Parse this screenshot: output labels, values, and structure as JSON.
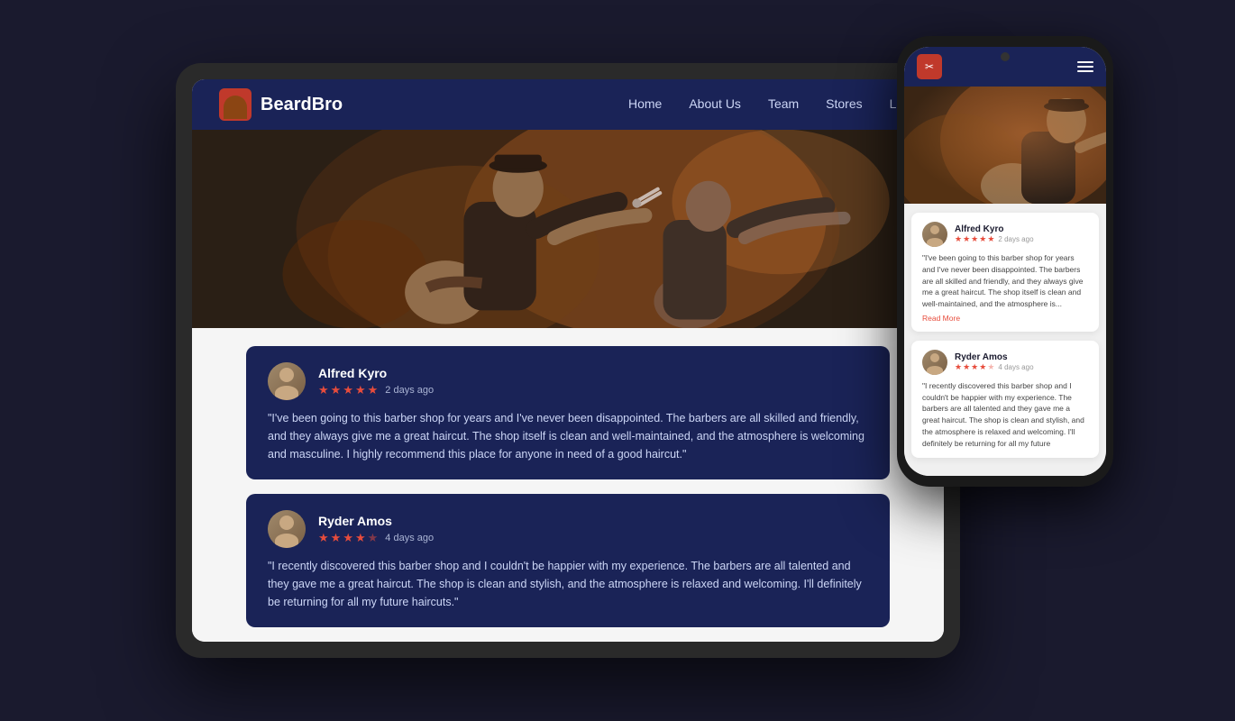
{
  "brand": {
    "name": "BeardBro",
    "logo_icon": "✂"
  },
  "nav": {
    "links": [
      "Home",
      "About Us",
      "Team",
      "Stores",
      "Labs"
    ]
  },
  "reviews": [
    {
      "id": 1,
      "name": "Alfred Kyro",
      "date": "2 days ago",
      "stars": 5,
      "half_star": false,
      "text": "\"I've been going to this barber shop for years and I've never been disappointed. The barbers are all skilled and friendly, and they always give me a great haircut. The shop itself is clean and well-maintained, and the atmosphere is welcoming and masculine. I highly recommend this place for anyone in need of a good haircut.\""
    },
    {
      "id": 2,
      "name": "Ryder Amos",
      "date": "4 days ago",
      "stars": 4,
      "half_star": true,
      "text": "\"I recently discovered this barber shop and I couldn't be happier with my experience. The barbers are all talented and they gave me a great haircut. The shop is clean and stylish, and the atmosphere is relaxed and welcoming. I'll definitely be returning for all my future haircuts.\""
    }
  ],
  "phone_reviews": [
    {
      "id": 1,
      "name": "Alfred Kyro",
      "date": "2 days ago",
      "stars": 5,
      "half_star": false,
      "text": "\"I've been going to this barber shop for years and I've never been disappointed. The barbers are all skilled and friendly, and they always give me a great haircut. The shop itself is clean and well-maintained, and the atmosphere is...",
      "read_more": "Read More"
    },
    {
      "id": 2,
      "name": "Ryder Amos",
      "date": "4 days ago",
      "stars": 4,
      "half_star": true,
      "text": "\"I recently discovered this barber shop and I couldn't be happier with my experience. The barbers are all talented and they gave me a great haircut. The shop is clean and stylish, and the atmosphere is relaxed and welcoming. I'll definitely be returning for all my future"
    }
  ],
  "colors": {
    "navbar_bg": "#1a2357",
    "review_card_bg": "#1a2357",
    "star_color": "#e74c3c",
    "read_more_color": "#e74c3c"
  }
}
